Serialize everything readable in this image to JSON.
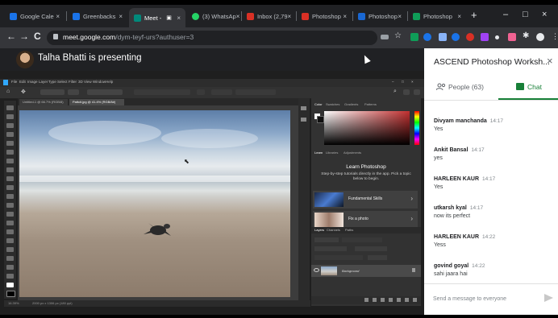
{
  "browser": {
    "tabs": [
      {
        "title": "Google Cale",
        "favicon_color": "#1a73e8"
      },
      {
        "title": "Greenbacks",
        "favicon_color": "#1a73e8"
      },
      {
        "title": "Meet -",
        "favicon_color": "#00897b",
        "active": true
      },
      {
        "title": "(3) WhatsAp",
        "favicon_color": "#25d366"
      },
      {
        "title": "Inbox (2,79",
        "favicon_color": "#d93025"
      },
      {
        "title": "Photoshop",
        "favicon_color": "#d93025"
      },
      {
        "title": "Photoshop",
        "favicon_color": "#1967d2"
      },
      {
        "title": "Photoshop",
        "favicon_color": "#0f9d58"
      }
    ],
    "close_glyph": "×",
    "new_tab": "+",
    "window_controls": [
      "–",
      "□",
      "×"
    ],
    "nav": {
      "back": "←",
      "forward": "→",
      "reload": "C"
    },
    "url_host": "meet.google.com",
    "url_path": "/dym-teyf-urs?authuser=3"
  },
  "meet": {
    "presenting_text": "Talha Bhatti is presenting"
  },
  "photoshop": {
    "menu": [
      "File",
      "Edit",
      "Image",
      "Layer",
      "Type",
      "Select",
      "Filter",
      "3D",
      "View",
      "Window",
      "Help"
    ],
    "doc_tabs": [
      "Untitled-1 @ 66.7% (RGB/8)",
      "Pattcit.jpg @ 41.4% (RGB/8#)"
    ],
    "color_tabs": [
      "Color",
      "Swatches",
      "Gradients",
      "Patterns"
    ],
    "learn_tabs": [
      "Learn",
      "Libraries",
      "Adjustments"
    ],
    "learn_title": "Learn Photoshop",
    "learn_desc": "Step-by-step tutorials directly in the app. Pick a topic below to begin.",
    "learn_cards": [
      {
        "label": "Fundamental Skills"
      },
      {
        "label": "Fix a photo"
      }
    ],
    "layer_tabs": [
      "Layers",
      "Channels",
      "Paths"
    ],
    "layer_name": "Background",
    "status": [
      "16.39%",
      "2000 px x 1306 px (180 ppi)"
    ]
  },
  "chat_panel": {
    "title": "ASCEND Photoshop Worksh...",
    "close": "×",
    "people_label": "People (63)",
    "chat_label": "Chat",
    "messages": [
      {
        "name": "Divyam manchanda",
        "time": "14:17",
        "text": "Yes"
      },
      {
        "name": "Ankit Bansal",
        "time": "14:17",
        "text": "yes"
      },
      {
        "name": "HARLEEN KAUR",
        "time": "14:17",
        "text": "Yes"
      },
      {
        "name": "utkarsh kyal",
        "time": "14:17",
        "text": "now its perfect"
      },
      {
        "name": "HARLEEN KAUR",
        "time": "14:22",
        "text": "Yess"
      },
      {
        "name": "govind goyal",
        "time": "14:22",
        "text": "sahi jaara hai"
      }
    ],
    "compose_placeholder": "Send a message to everyone"
  },
  "colors": {
    "accent_green": "#188038",
    "chrome_dark": "#202124",
    "ps_panel": "#323232"
  }
}
